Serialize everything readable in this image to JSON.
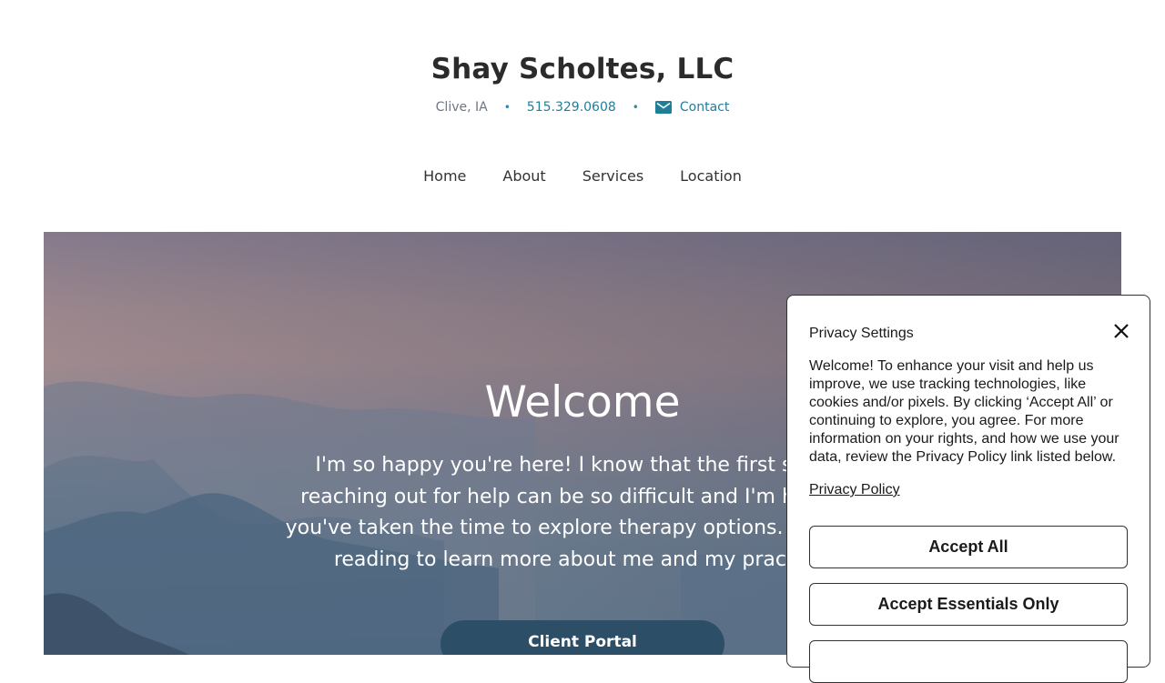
{
  "header": {
    "site_title": "Shay Scholtes, LLC",
    "city": "Clive, IA",
    "separator": "•",
    "phone": "515.329.0608",
    "contact_label": "Contact",
    "contact_icon": "mail-icon"
  },
  "nav": {
    "items": [
      {
        "label": "Home"
      },
      {
        "label": "About"
      },
      {
        "label": "Services"
      },
      {
        "label": "Location"
      }
    ]
  },
  "hero": {
    "title": "Welcome",
    "text": "I'm so happy you're here! I know that the first step in reaching out for help can be so difficult and I'm honored you've taken the time to explore therapy options. Continue reading to learn more about me and my practice!",
    "button_label": "Client Portal"
  },
  "privacy": {
    "title": "Privacy Settings",
    "close_icon": "close-icon",
    "body": "Welcome! To enhance your visit and help us improve, we use tracking technologies, like cookies and/or pixels. By clicking ‘Accept All’ or continuing to explore, you agree. For more information on your rights, and how we use your data, review the Privacy Policy link listed below.",
    "policy_link": "Privacy Policy",
    "accept_all": "Accept All",
    "accept_essentials": "Accept Essentials Only"
  },
  "colors": {
    "link": "#1f7f99",
    "button_dark": "#2c4e66"
  }
}
